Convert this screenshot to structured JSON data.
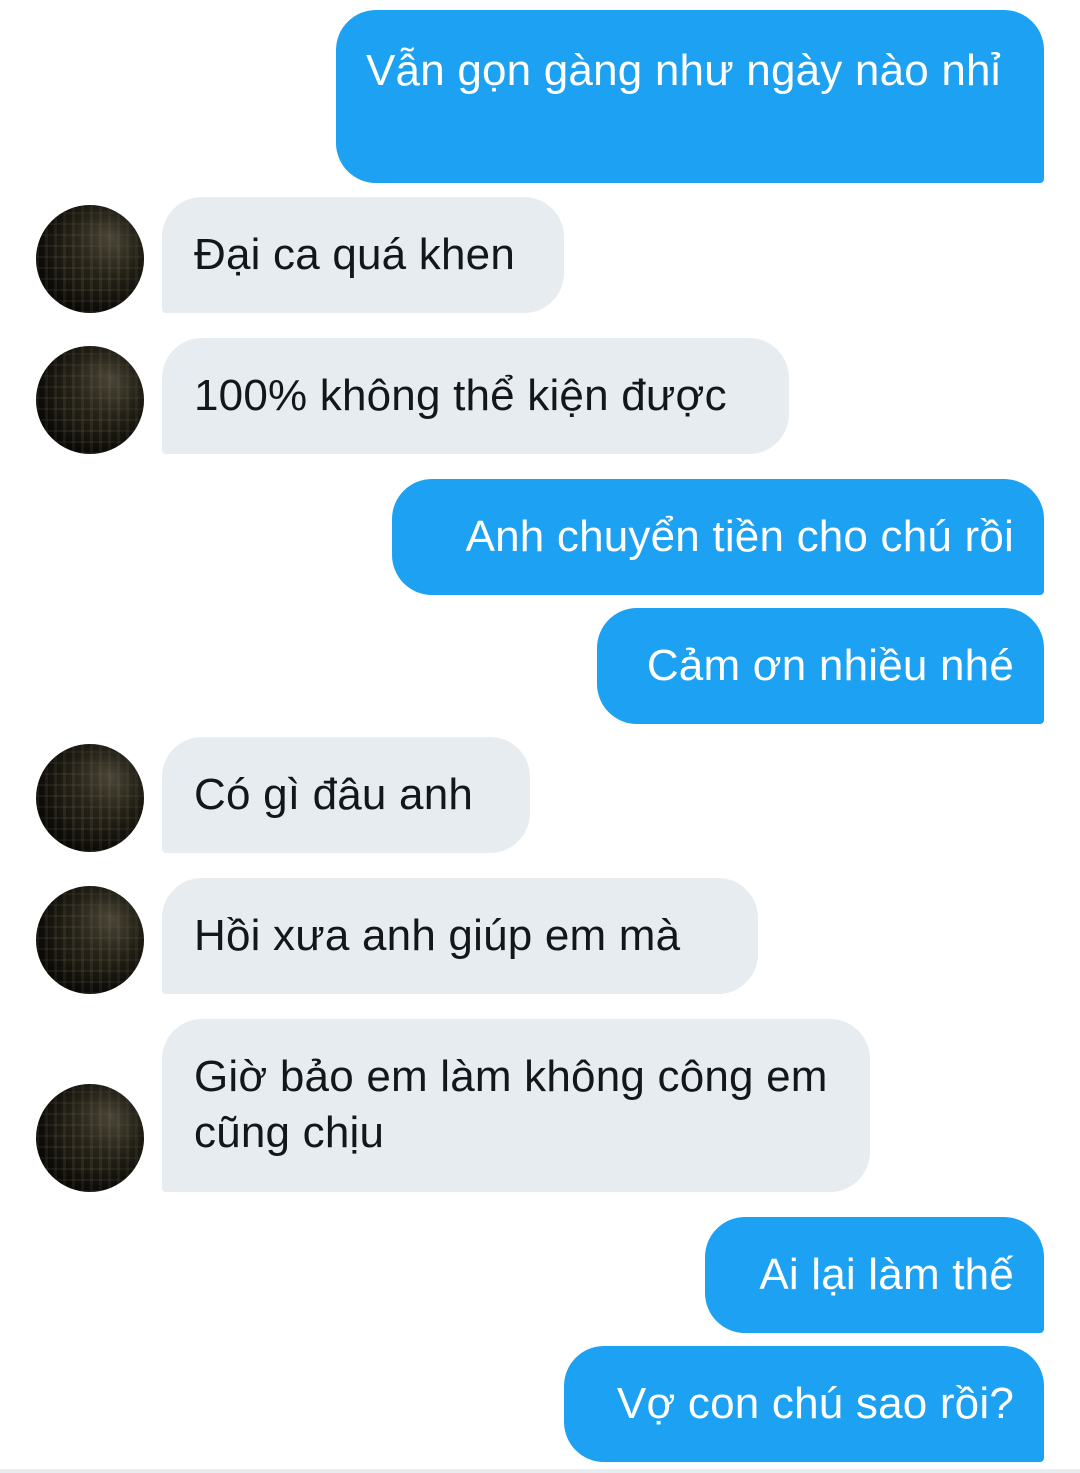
{
  "messages": [
    {
      "from": "me",
      "text": "Vẫn gọn gàng như ngày nào nhỉ"
    },
    {
      "from": "them",
      "text": "Đại ca quá khen"
    },
    {
      "from": "them",
      "text": "100% không thể kiện được"
    },
    {
      "from": "me",
      "text": "Anh chuyển tiền cho chú rồi"
    },
    {
      "from": "me",
      "text": "Cảm ơn nhiều nhé"
    },
    {
      "from": "them",
      "text": "Có gì đâu anh"
    },
    {
      "from": "them",
      "text": "Hồi xưa anh giúp em mà"
    },
    {
      "from": "them",
      "text": "Giờ bảo em làm không công em cũng chịu"
    },
    {
      "from": "me",
      "text": "Ai lại làm thế"
    },
    {
      "from": "me",
      "text": "Vợ con chú sao rồi?"
    }
  ],
  "colors": {
    "outgoing_bubble": "#1da1f2",
    "incoming_bubble": "#e6ecf0",
    "outgoing_text": "#ffffff",
    "incoming_text": "#14171a"
  }
}
